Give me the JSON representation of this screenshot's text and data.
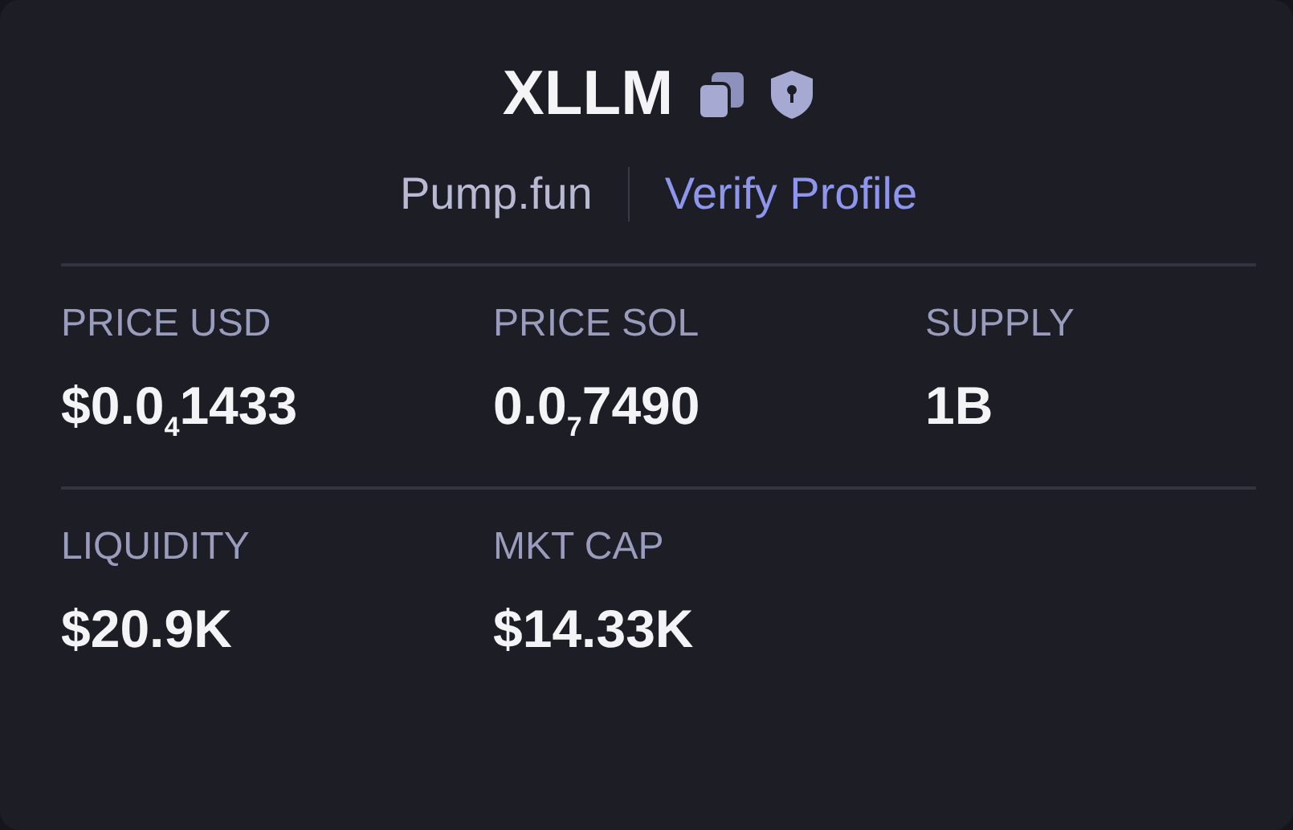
{
  "token": {
    "name": "XLLM",
    "platform": "Pump.fun",
    "verify_link": "Verify Profile"
  },
  "stats": [
    {
      "label": "PRICE USD",
      "value": "$0.0$_{4}$1433"
    },
    {
      "label": "PRICE SOL",
      "value": "0.0$_{7}$7490"
    },
    {
      "label": "SUPPLY",
      "value": "1B"
    },
    {
      "label": "LIQUIDITY",
      "value": "$20.9K"
    },
    {
      "label": "MKT CAP",
      "value": "$14.33K"
    }
  ]
}
